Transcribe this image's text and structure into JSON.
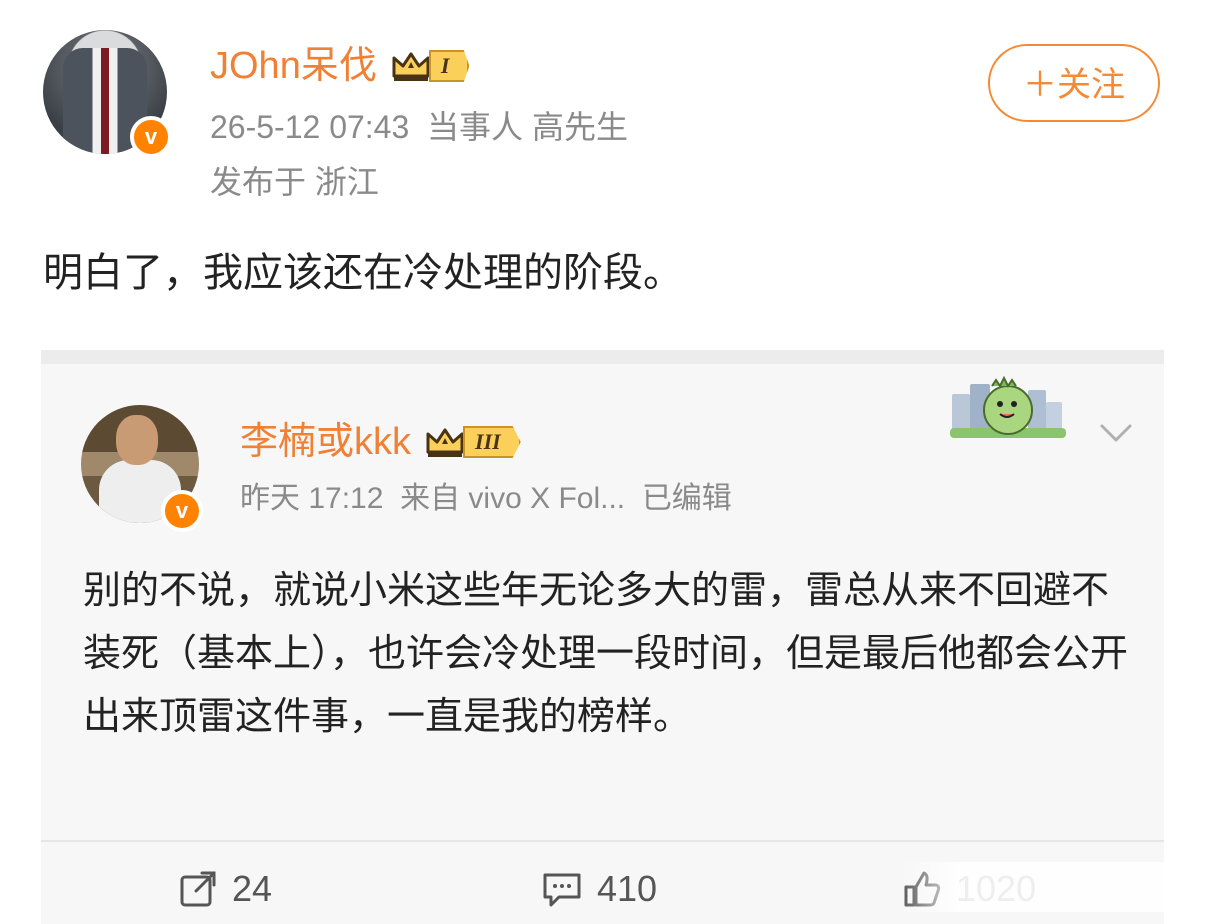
{
  "post": {
    "username": "JOhn呆伐",
    "level_badge": "I",
    "verified_mark": "v",
    "timestamp": "26-5-12 07:43",
    "role_tag": "当事人 高先生",
    "location": "发布于 浙江",
    "follow_button": "＋关注",
    "text": "明白了，我应该还在冷处理的阶段。"
  },
  "quoted": {
    "username": "李楠或kkk",
    "level_badge": "III",
    "verified_mark": "v",
    "time": "昨天 17:12",
    "source": "来自 vivo X Fol...",
    "edited": "已编辑",
    "text": "别的不说，就说小米这些年无论多大的雷，雷总从来不回避不装死（基本上），也许会冷处理一段时间，但是最后他都会公开出来顶雷这件事，一直是我的榜样。"
  },
  "actions": {
    "repost_count": "24",
    "comment_count": "410",
    "like_count": "1020"
  },
  "icons": {
    "crown": "crown-icon",
    "repost": "share-icon",
    "comment": "comment-icon",
    "like": "like-icon",
    "chevron": "chevron-down-icon",
    "sticker": "dinosaur-sticker-icon"
  },
  "colors": {
    "accent_orange": "#f08033",
    "verified_orange": "#ff8200",
    "badge_gold": "#fbd05a",
    "meta_gray": "#8a8a8a",
    "card_bg": "#f7f7f7"
  }
}
